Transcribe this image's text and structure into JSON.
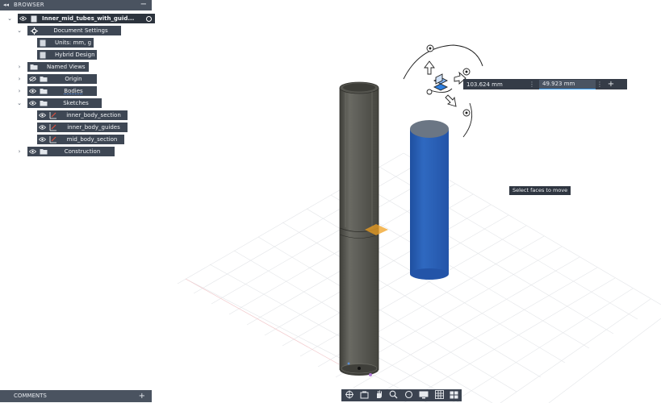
{
  "browser": {
    "title": "BROWSER",
    "collapse_glyph": "◂◂",
    "minimize_glyph": "−",
    "root": {
      "label": "Inner_mid_tubes_with_guid...",
      "icon": "document-icon"
    },
    "items": {
      "document_settings": {
        "label": "Document Settings",
        "icon": "gear-icon"
      },
      "units": {
        "label": "Units: mm, g",
        "icon": "units-icon"
      },
      "hybrid_design": {
        "label": "Hybrid Design",
        "icon": "design-icon"
      },
      "named_views": {
        "label": "Named Views",
        "icon": "folder-icon"
      },
      "origin": {
        "label": "Origin",
        "icon": "folder-icon"
      },
      "bodies": {
        "label": "Bodies",
        "icon": "folder-icon"
      },
      "sketches": {
        "label": "Sketches",
        "icon": "folder-icon"
      },
      "sketch_1": {
        "label": "inner_body_section",
        "icon": "sketch-icon"
      },
      "sketch_2": {
        "label": "inner_body_guides",
        "icon": "sketch-icon"
      },
      "sketch_3": {
        "label": "mid_body_section",
        "icon": "sketch-icon"
      },
      "construction": {
        "label": "Construction",
        "icon": "folder-icon"
      }
    }
  },
  "comments": {
    "title": "COMMENTS",
    "add_glyph": "+"
  },
  "move_dialog": {
    "distance_1": "103.624 mm",
    "distance_2": "49.923 mm",
    "add_glyph": "+"
  },
  "tooltip": "Select faces to move",
  "nav_toolbar": {
    "tools": [
      "orbit-icon",
      "look-at-icon",
      "pan-icon",
      "zoom-icon",
      "fit-icon",
      "display-settings-icon",
      "grid-icon",
      "viewports-icon"
    ]
  },
  "colors": {
    "panel_bg": "#4a5360",
    "node_bg": "#3e4754",
    "tube_gray": "#5c5c55",
    "blue_body": "#2b63b6",
    "highlight_orange": "#f0a020"
  }
}
